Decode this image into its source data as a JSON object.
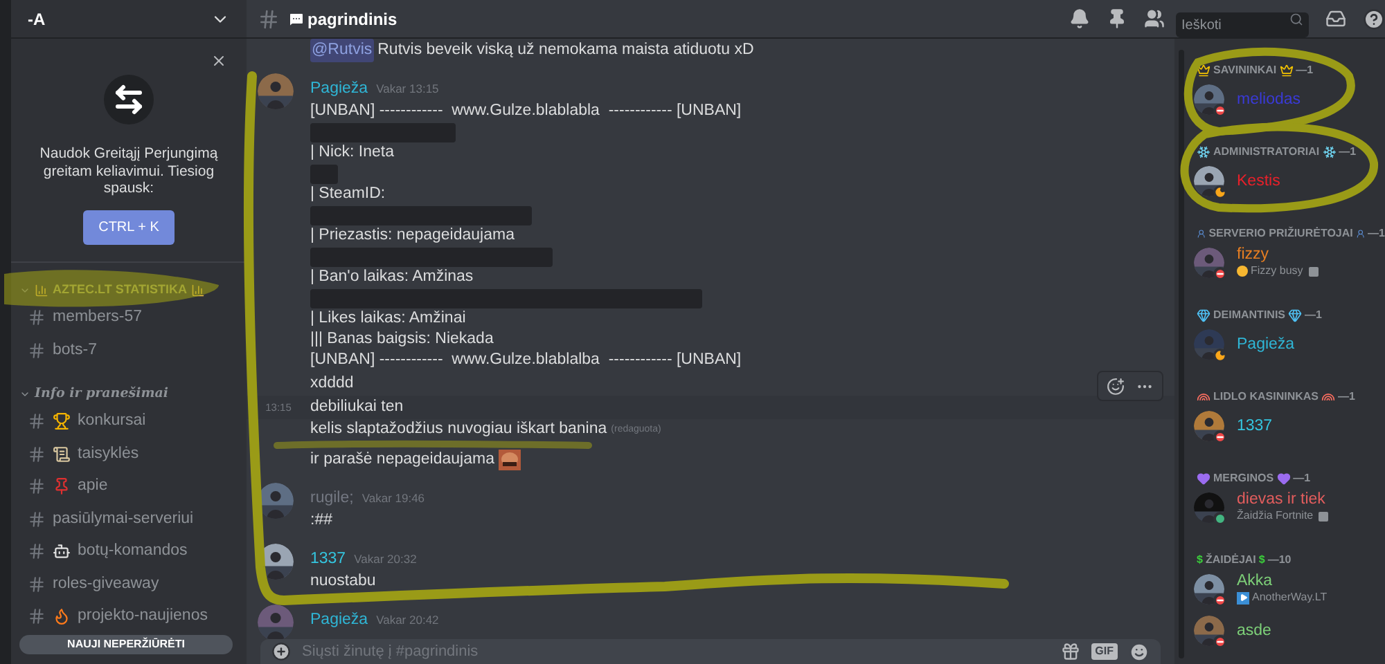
{
  "server": {
    "name": "-A"
  },
  "tip": {
    "text": "Naudok Greitąjį Perjungimą greitam keliavimui. Tiesiog spausk:",
    "button": "CTRL + K"
  },
  "categories": [
    {
      "name": "AZTEC.LT STATISTIKA",
      "kind": "caps",
      "channels": [
        {
          "name": "members-57"
        },
        {
          "name": "bots-7"
        }
      ]
    },
    {
      "name": "Info ir pranešimai",
      "kind": "fancy",
      "channels": [
        {
          "name": "konkursai"
        },
        {
          "name": "taisyklės"
        },
        {
          "name": "apie"
        },
        {
          "name": "pasiūlymai-serveriui"
        },
        {
          "name": "botų-komandos"
        },
        {
          "name": "roles-giveaway"
        },
        {
          "name": "projekto-naujienos"
        }
      ]
    }
  ],
  "unread_pill": "NAUJI NEPERŽIŪRĖTI",
  "channel": {
    "name": "pagrindinis"
  },
  "search": {
    "placeholder": "Ieškoti"
  },
  "message_groups": [
    {
      "messages": [
        {
          "lines": [
            {
              "kind": "text",
              "mention": "@Rutvis",
              "text": "Rutvis beveik viską už nemokama maista atiduotu xD"
            }
          ]
        }
      ]
    },
    {
      "author": "Pagieža",
      "color": "#2fb6d6",
      "time": "Vakar 13:15",
      "messages": [
        {
          "lines": [
            {
              "kind": "text",
              "text": "[UNBAN] ------------  www.Gulze.blablabla  ------------ [UNBAN]"
            },
            {
              "kind": "redacted"
            },
            {
              "kind": "text",
              "text": "| Nick: Ineta"
            },
            {
              "kind": "redacted"
            },
            {
              "kind": "text",
              "text": "| SteamID:"
            },
            {
              "kind": "redacted"
            },
            {
              "kind": "text",
              "text": "| Priezastis: nepageidaujama"
            },
            {
              "kind": "redacted"
            },
            {
              "kind": "text",
              "text": "| Ban'o laikas: Amžinas"
            },
            {
              "kind": "redacted"
            },
            {
              "kind": "text",
              "text": "| Likes laikas: Amžinai"
            },
            {
              "kind": "text",
              "text": "||| Banas baigsis: Niekada"
            },
            {
              "kind": "text",
              "text": "[UNBAN] ------------  www.Gulze.blablalba  ------------ [UNBAN]"
            }
          ]
        },
        {
          "lines": [
            {
              "kind": "text",
              "text": "xdddd"
            }
          ]
        },
        {
          "hovered": true,
          "time": "13:15",
          "lines": [
            {
              "kind": "text",
              "text": "debiliukai ten"
            }
          ]
        },
        {
          "lines": [
            {
              "kind": "text",
              "text": "kelis slaptažodžius nuvogiau iškart banina",
              "edited": "(redaguota)"
            }
          ]
        },
        {
          "lines": [
            {
              "kind": "text",
              "text": "ir parašė nepageidaujama",
              "custom_emoji": true
            }
          ]
        }
      ]
    },
    {
      "author": "rugile;",
      "color": "#747882",
      "time": "Vakar 19:46",
      "messages": [
        {
          "lines": [
            {
              "kind": "text",
              "text": ":##"
            }
          ]
        }
      ]
    },
    {
      "author": "1337",
      "color": "#34c6e0",
      "time": "Vakar 20:32",
      "messages": [
        {
          "lines": [
            {
              "kind": "text",
              "text": "nuostabu"
            }
          ]
        }
      ]
    },
    {
      "author": "Pagieža",
      "color": "#2fb6d6",
      "time": "Vakar 20:42"
    }
  ],
  "composer": {
    "placeholder": "Siųsti žinutę į #pagrindinis",
    "gif": "GIF"
  },
  "member_groups": [
    {
      "name": "SAVININKAI",
      "count": "—1",
      "members": [
        {
          "name": "meliodas",
          "color": "#3a3ad6",
          "kind": "dnd"
        }
      ]
    },
    {
      "name": "ADMINISTRATORIAI",
      "count": "—1",
      "members": [
        {
          "name": "Kestis",
          "color": "#e8202a",
          "kind": "idle"
        }
      ]
    },
    {
      "name": "SERVERIO PRIŽIURĖTOJAI",
      "count": "—1",
      "members": [
        {
          "name": "fizzy",
          "color": "#e67e22",
          "kind": "dnd",
          "activity": {
            "kind": "custom",
            "text": "Fizzy busy"
          }
        }
      ]
    },
    {
      "name": "DEIMANTINIS",
      "count": "—1",
      "members": [
        {
          "name": "Pagieža",
          "color": "#2fb6d6",
          "kind": "idle"
        }
      ]
    },
    {
      "name": "LIDLO KASININKAS",
      "count": "—1",
      "members": [
        {
          "name": "1337",
          "color": "#34c6e0",
          "kind": "dnd"
        }
      ]
    },
    {
      "name": "MERGINOS",
      "count": "—1",
      "members": [
        {
          "name": "dievas ir tiek",
          "color": "#e35d5d",
          "kind": "online",
          "activity": {
            "kind": "game",
            "text": "Žaidžia Fortnite"
          }
        }
      ]
    },
    {
      "name": "ŽAIDĖJAI",
      "mark": "$",
      "count": "—10",
      "members": [
        {
          "name": "Akka",
          "color": "#7dcf78",
          "kind": "dnd",
          "activity": {
            "kind": "stream",
            "text": "AnotherWay.LT"
          }
        },
        {
          "name": "asde",
          "color": "#7dcf78",
          "kind": "dnd"
        }
      ]
    }
  ]
}
